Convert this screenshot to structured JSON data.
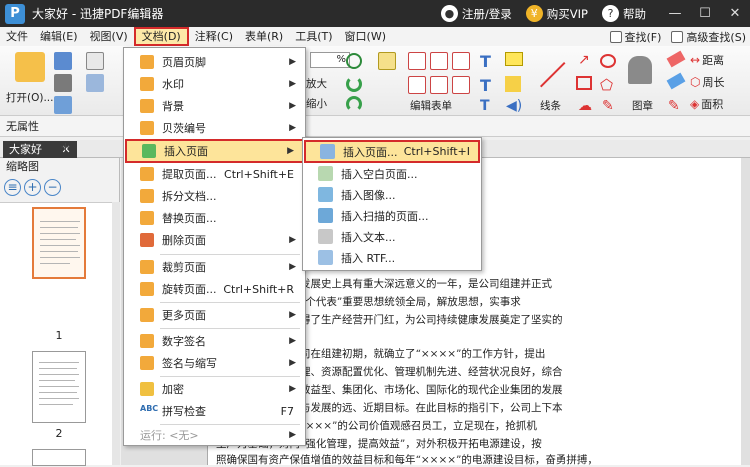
{
  "app": {
    "title": "大家好 - 迅捷PDF编辑器",
    "logo": "P"
  },
  "titlebar": {
    "login": "注册/登录",
    "vip": "购买VIP",
    "help": "帮助",
    "min": "—",
    "max": "☐",
    "close": "✕"
  },
  "menubar": {
    "items": [
      "文件",
      "编辑(E)",
      "视图(V)",
      "文档(D)",
      "注释(C)",
      "表单(R)",
      "工具(T)",
      "窗口(W)"
    ],
    "find": "查找(F)",
    "advanced_find": "高级查找(S)"
  },
  "ribbon": {
    "open": "打开(O)...",
    "zoom_percent": "%",
    "enlarge": "放大",
    "shrink": "缩小",
    "edit_form": "编辑表单",
    "lines": "线条",
    "stamp": "图章",
    "distance": "距离",
    "perimeter": "周长",
    "area": "面积"
  },
  "attributes_bar": "无属性",
  "document_tab": {
    "label": "大家好",
    "close": "✕",
    "add": "+"
  },
  "thumbnails": {
    "title": "缩略图",
    "pages": [
      "1",
      "2"
    ]
  },
  "document_menu": {
    "items": [
      {
        "label": "页眉页脚",
        "arrow": "▶"
      },
      {
        "label": "水印",
        "arrow": "▶"
      },
      {
        "label": "背景",
        "arrow": "▶"
      },
      {
        "label": "贝茨编号",
        "arrow": "▶"
      },
      {
        "label": "插入页面",
        "arrow": "▶"
      },
      {
        "label": "提取页面...",
        "shortcut": "Ctrl+Shift+E"
      },
      {
        "label": "拆分文档..."
      },
      {
        "label": "替换页面..."
      },
      {
        "label": "删除页面",
        "arrow": "▶"
      },
      {
        "label": "裁剪页面",
        "arrow": "▶"
      },
      {
        "label": "旋转页面...",
        "shortcut": "Ctrl+Shift+R"
      },
      {
        "label": "更多页面",
        "arrow": "▶"
      },
      {
        "label": "数字签名",
        "arrow": "▶"
      },
      {
        "label": "签名与缩写",
        "arrow": "▶"
      },
      {
        "label": "加密",
        "arrow": "▶"
      },
      {
        "label": "拼写检查",
        "shortcut": "F7"
      },
      {
        "label": "运行: <无>",
        "arrow": "▶"
      }
    ]
  },
  "insert_submenu": {
    "items": [
      {
        "label": "插入页面...",
        "shortcut": "Ctrl+Shift+I"
      },
      {
        "label": "插入空白页面..."
      },
      {
        "label": "插入图像..."
      },
      {
        "label": "插入扫描的页面..."
      },
      {
        "label": "插入文本..."
      },
      {
        "label": "插入 RTF..."
      }
    ]
  },
  "document_text": [
    "ㅤ                                      持，向公司的广大员工、家属们以",
    "ㅤ                                      事业的社会各界人士表示衷心的感",
    "ㅤ",
    "，是中国电力工业发展史上具有重大深远意义的一年，是公司组建并正式",
    "中一年，公司以“三个代表”重要思想统领全局，解放思想，实事求",
    "进，开拓进取，取得了生产经营开门红，为公司持续健康发展奠定了坚实的",
    "ㅤ",
    "公司第一要务。公司在组建初期，就确立了“××××”的工作方针，提出",
    "设成为要素组合合理、资源配置优化、管理机制先进、经营状况良好，综合",
    "复合控股型、规模效益型、集团化、市场化、国际化的现代企业集团的发展",
    "并明确了公司改革与发展的远、近期目标。在此目标的指引下，公司上下本",
    "××”的理念，以“××××”的公司价值观感召员工，立足现在，抢抓机",
    "生产为基础，对内“强化管理，提高效益”，对外积极开拓电源建设，按",
    "照确保国有资产保值增值的效益目标和每年“××××”的电源建设目标，奋勇拼搏，"
  ],
  "colors": {
    "accent_red": "#d42a2a",
    "highlight": "#fde49a",
    "titlebar": "#2b2b2b"
  }
}
